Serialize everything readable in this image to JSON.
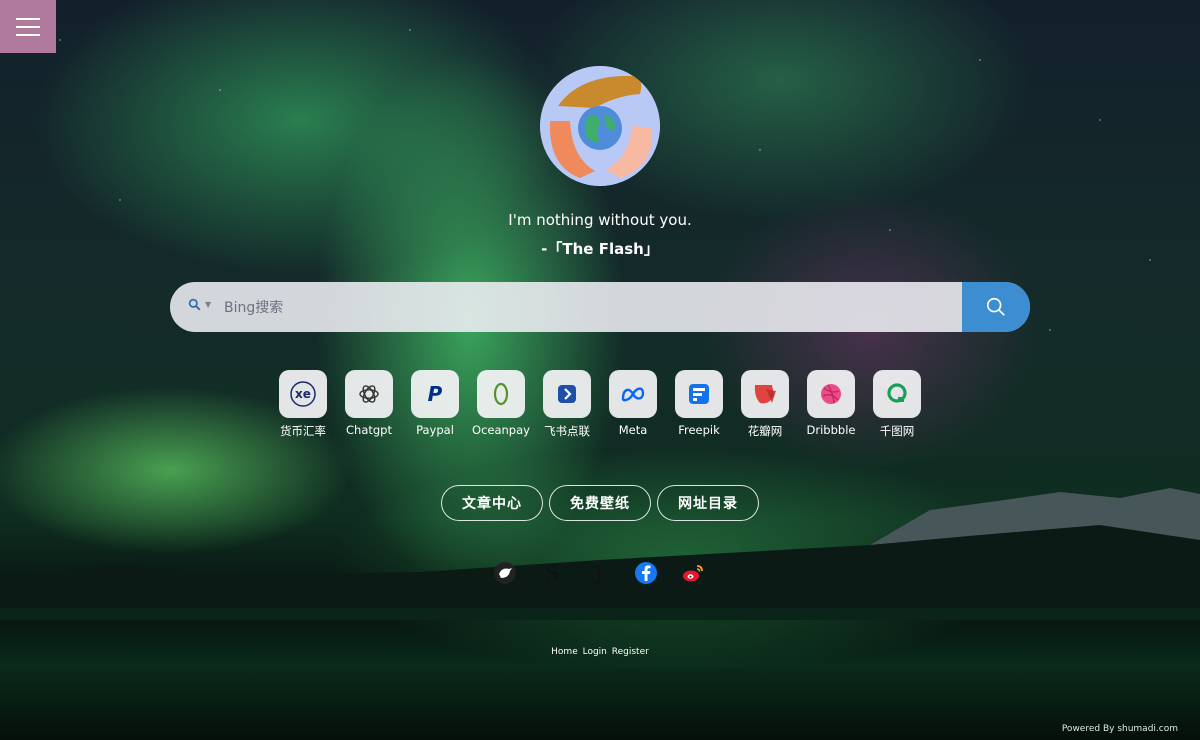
{
  "quote": {
    "line1": "I'm nothing without you.",
    "line2": "-「The Flash」"
  },
  "search": {
    "placeholder": "Bing搜索",
    "accent": "#3d8ed1"
  },
  "apps": [
    {
      "label": "货币汇率",
      "icon": "xe-icon"
    },
    {
      "label": "Chatgpt",
      "icon": "chatgpt-icon"
    },
    {
      "label": "Paypal",
      "icon": "paypal-icon"
    },
    {
      "label": "Oceanpay",
      "icon": "oceanpay-icon"
    },
    {
      "label": "飞书点联",
      "icon": "feishu-icon"
    },
    {
      "label": "Meta",
      "icon": "meta-icon"
    },
    {
      "label": "Freepik",
      "icon": "freepik-icon"
    },
    {
      "label": "花瓣网",
      "icon": "huaban-icon"
    },
    {
      "label": "Dribbble",
      "icon": "dribbble-icon"
    },
    {
      "label": "千图网",
      "icon": "qiantu-icon"
    }
  ],
  "pills": {
    "articles": "文章中心",
    "wallpapers": "免费壁纸",
    "directory": "网址目录"
  },
  "social": [
    {
      "name": "bird-icon"
    },
    {
      "name": "s-icon",
      "glyph": "S"
    },
    {
      "name": "j-icon",
      "glyph": "J"
    },
    {
      "name": "facebook-icon"
    },
    {
      "name": "weibo-icon"
    }
  ],
  "footer": {
    "home": "Home",
    "login": "Login",
    "register": "Register",
    "powered": "Powered By shumadi.com"
  }
}
